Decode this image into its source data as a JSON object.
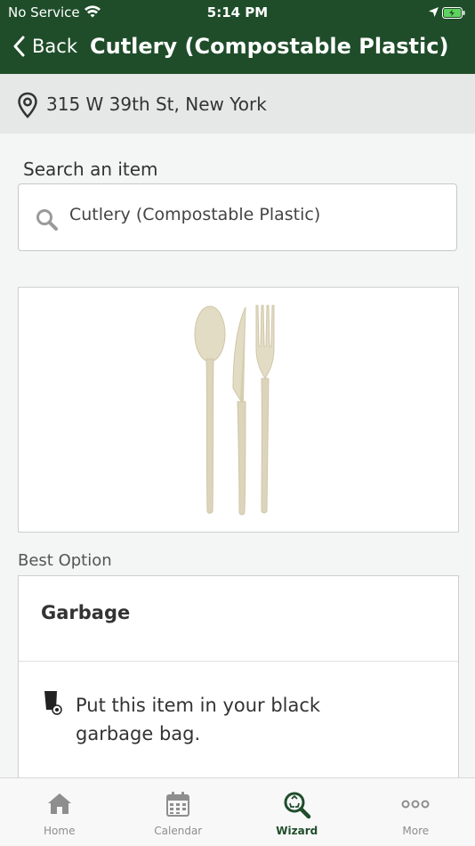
{
  "status": {
    "carrier": "No Service",
    "time": "5:14 PM"
  },
  "nav": {
    "back_label": "Back",
    "title": "Cutlery (Compostable Plastic)"
  },
  "location": {
    "address": "315 W 39th St, New York",
    "icon": "location-pin-icon"
  },
  "search": {
    "label": "Search an item",
    "value": "Cutlery (Compostable Plastic)"
  },
  "item_image": {
    "alt": "Cutlery (Compostable Plastic)"
  },
  "best_option": {
    "label": "Best Option",
    "title": "Garbage",
    "instruction": "Put this item in your black garbage bag.",
    "icon": "garbage-bin-icon"
  },
  "tabs": [
    {
      "label": "Home",
      "icon": "home-icon",
      "active": false
    },
    {
      "label": "Calendar",
      "icon": "calendar-icon",
      "active": false
    },
    {
      "label": "Wizard",
      "icon": "wizard-search-icon",
      "active": true
    },
    {
      "label": "More",
      "icon": "more-icon",
      "active": false
    }
  ],
  "colors": {
    "header": "#1f4d2a",
    "accent": "#1f4d2a",
    "tab_inactive": "#8e8e8e"
  }
}
